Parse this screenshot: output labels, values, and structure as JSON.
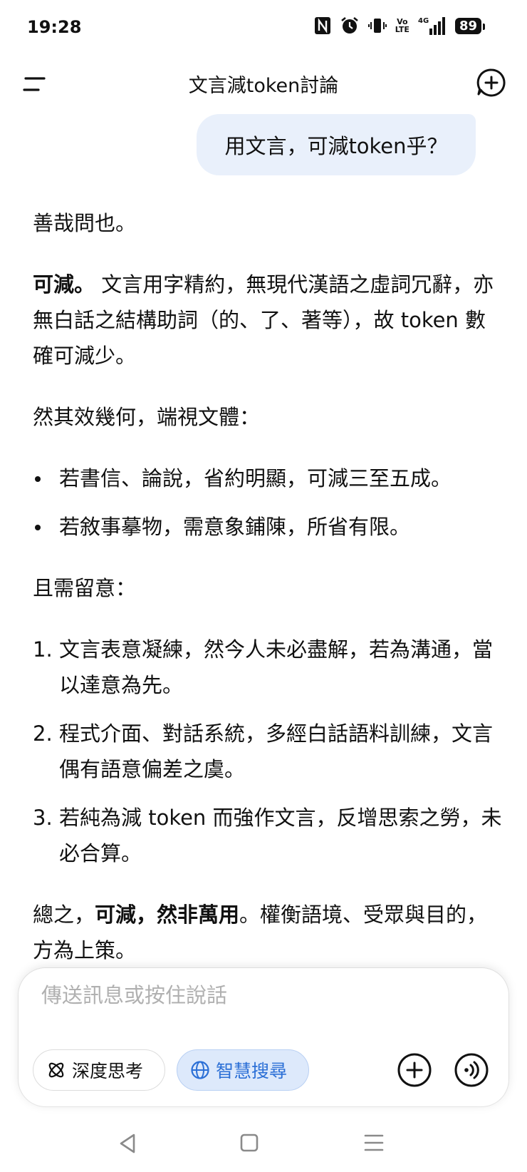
{
  "status_bar": {
    "time": "19:28",
    "icons": [
      "nfc-icon",
      "alarm-icon",
      "vibrate-icon",
      "volte-icon",
      "signal-4g-icon",
      "battery-icon"
    ],
    "volte_top": "Vo",
    "volte_bottom": "LTE",
    "network": "4G",
    "battery": "89"
  },
  "header": {
    "title": "文言減token討論",
    "menu_icon": "menu-icon",
    "new_chat_icon": "new-chat-icon"
  },
  "conversation": {
    "user_message": "用文言，可減token乎？",
    "answer": {
      "p1": "善哉問也。",
      "p2_bold": "可減。",
      "p2_rest": " 文言用字精約，無現代漢語之虛詞冗辭，亦無白話之結構助詞（的、了、著等），故 token 數確可減少。",
      "p3": "然其效幾何，端視文體：",
      "bullets": [
        "若書信、論說，省約明顯，可減三至五成。",
        "若敘事摹物，需意象鋪陳，所省有限。"
      ],
      "p4": "且需留意：",
      "numbered": [
        {
          "num": "1.",
          "text": "文言表意凝練，然今人未必盡解，若為溝通，當以達意為先。"
        },
        {
          "num": "2.",
          "text": "程式介面、對話系統，多經白話語料訓練，文言偶有語意偏差之虞。"
        },
        {
          "num": "3.",
          "text": "若純為減 token 而強作文言，反增思索之勞，未必合算。"
        }
      ],
      "p5_pre": "總之，",
      "p5_bold": "可減，然非萬用",
      "p5_post": "。權衡語境、受眾與目的，方為上策。"
    }
  },
  "composer": {
    "placeholder": "傳送訊息或按住說話",
    "deep_think_label": "深度思考",
    "smart_search_label": "智慧搜尋",
    "accent_color": "#2b6fd6"
  },
  "nav_bar": {
    "icons": [
      "back-icon",
      "home-icon",
      "recents-icon"
    ]
  }
}
